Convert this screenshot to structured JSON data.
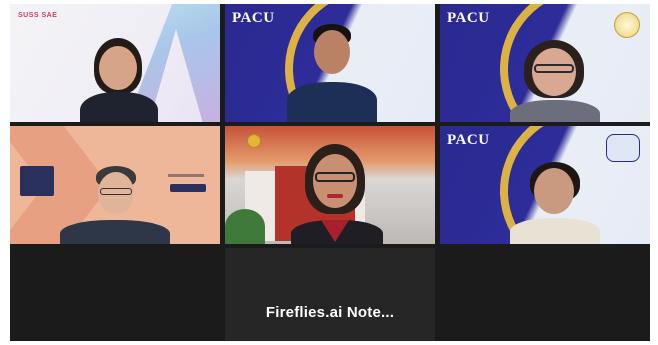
{
  "meeting": {
    "participants": [
      {
        "id": "p1",
        "name": "",
        "backdrop_logo": "SUSS SAE"
      },
      {
        "id": "p2",
        "name": "",
        "backdrop_logo": "PACU"
      },
      {
        "id": "p3",
        "name": "",
        "backdrop_logo": "PACU"
      },
      {
        "id": "p4",
        "name": "",
        "backdrop_logo": ""
      },
      {
        "id": "p5",
        "name": "",
        "backdrop_logo": ""
      },
      {
        "id": "p6",
        "name": "",
        "backdrop_logo": "PACU"
      }
    ],
    "notetaker": {
      "label": "Fireflies.ai Note..."
    }
  },
  "colors": {
    "grid_bg": "#1b1b1b",
    "pacu_blue": "#2b2a8f",
    "pacu_gold": "#f0c23a",
    "peach": "#efb79a",
    "notetaker_text": "#ffffff"
  }
}
